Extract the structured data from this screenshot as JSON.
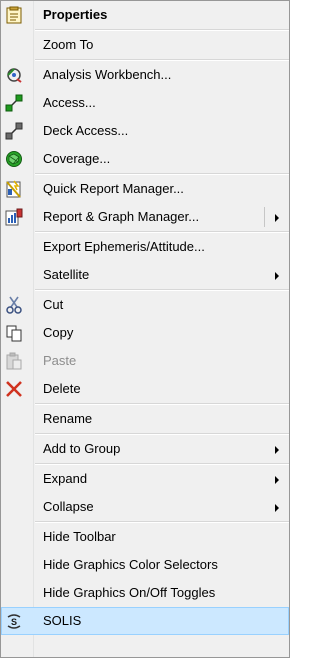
{
  "menu": {
    "properties": "Properties",
    "zoom_to": "Zoom To",
    "analysis_workbench": "Analysis Workbench...",
    "access": "Access...",
    "deck_access": "Deck Access...",
    "coverage": "Coverage...",
    "quick_report_manager": "Quick Report Manager...",
    "report_graph_manager": "Report & Graph Manager...",
    "export_ephemeris": "Export Ephemeris/Attitude...",
    "satellite": "Satellite",
    "cut": "Cut",
    "copy": "Copy",
    "paste": "Paste",
    "delete": "Delete",
    "rename": "Rename",
    "add_to_group": "Add to Group",
    "expand": "Expand",
    "collapse": "Collapse",
    "hide_toolbar": "Hide Toolbar",
    "hide_color_selectors": "Hide Graphics Color Selectors",
    "hide_onoff_toggles": "Hide Graphics On/Off Toggles",
    "solis": "SOLIS"
  },
  "icons": {
    "properties": "properties-icon",
    "analysis_workbench": "analysis-workbench-icon",
    "access": "access-icon",
    "deck_access": "deck-access-icon",
    "coverage": "coverage-icon",
    "quick_report": "quick-report-icon",
    "report_graph": "report-graph-icon",
    "cut": "scissors-icon",
    "copy": "copy-icon",
    "paste": "paste-icon",
    "delete": "delete-x-icon",
    "solis": "solis-icon"
  },
  "colors": {
    "highlight": "#cce8ff",
    "delete": "#d0321f",
    "disabled_text": "#8d8d8d"
  }
}
